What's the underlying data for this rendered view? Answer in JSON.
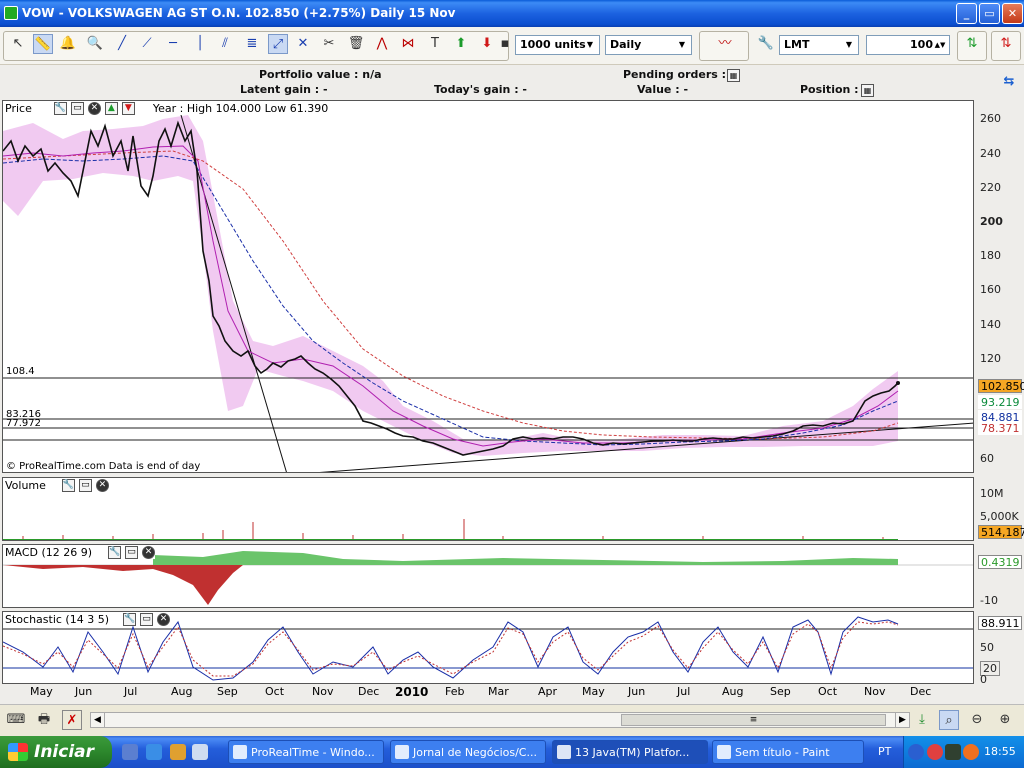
{
  "window": {
    "title": "VOW  -  VOLKSWAGEN AG ST O.N.     102.850 (+2.75%)     Daily  15 Nov",
    "buttons": [
      "_",
      "▭",
      "✕"
    ]
  },
  "toolbar": {
    "quantity": "1000 units",
    "period": "Daily",
    "order_type": "LMT",
    "order_qty": "100"
  },
  "info": {
    "portfolio_value": "Portfolio value : n/a",
    "latent_gain": "Latent gain : -",
    "todays_gain": "Today's gain : -",
    "pending_orders": "Pending orders : 0",
    "value": "Value : -",
    "position": "Position : 0"
  },
  "price_panel": {
    "title": "Price",
    "year_info": "Year : High 104.000 Low 61.390",
    "source": "© ProRealTime.com  Data is end of day",
    "level_labels": [
      "108.4",
      "83.216",
      "77.972"
    ],
    "axis_ticks": [
      "260",
      "240",
      "220",
      "200",
      "180",
      "160",
      "140",
      "120",
      "100",
      "80",
      "60"
    ],
    "current_price": "102.850",
    "boxes": [
      "93.219",
      "84.881",
      "78.371"
    ],
    "colors": {
      "current": "#f5a623",
      "green": "#0a8a3a",
      "blue": "#1030a0",
      "red": "#c03030"
    }
  },
  "volume_panel": {
    "title": "Volume",
    "axis_ticks": [
      "10M",
      "5,000K"
    ],
    "current": "514,187"
  },
  "macd_panel": {
    "title": "MACD (12 26 9)",
    "axis_ticks": [
      "0",
      "-10"
    ],
    "current": "0.4319"
  },
  "stoch_panel": {
    "title": "Stochastic (14 3 5)",
    "axis_ticks": [
      "50",
      "20",
      "0"
    ],
    "current": "88.911"
  },
  "time_axis": [
    "May",
    "Jun",
    "Jul",
    "Aug",
    "Sep",
    "Oct",
    "Nov",
    "Dec",
    "2010",
    "Feb",
    "Mar",
    "Apr",
    "May",
    "Jun",
    "Jul",
    "Aug",
    "Sep",
    "Oct",
    "Nov",
    "Dec"
  ],
  "taskbar": {
    "start": "Iniciar",
    "tasks": [
      "ProRealTime - Windo...",
      "Jornal de Negócios/C...",
      "13 Java(TM) Platfor...",
      "Sem título - Paint"
    ],
    "lang": "PT",
    "clock": "18:55"
  }
}
